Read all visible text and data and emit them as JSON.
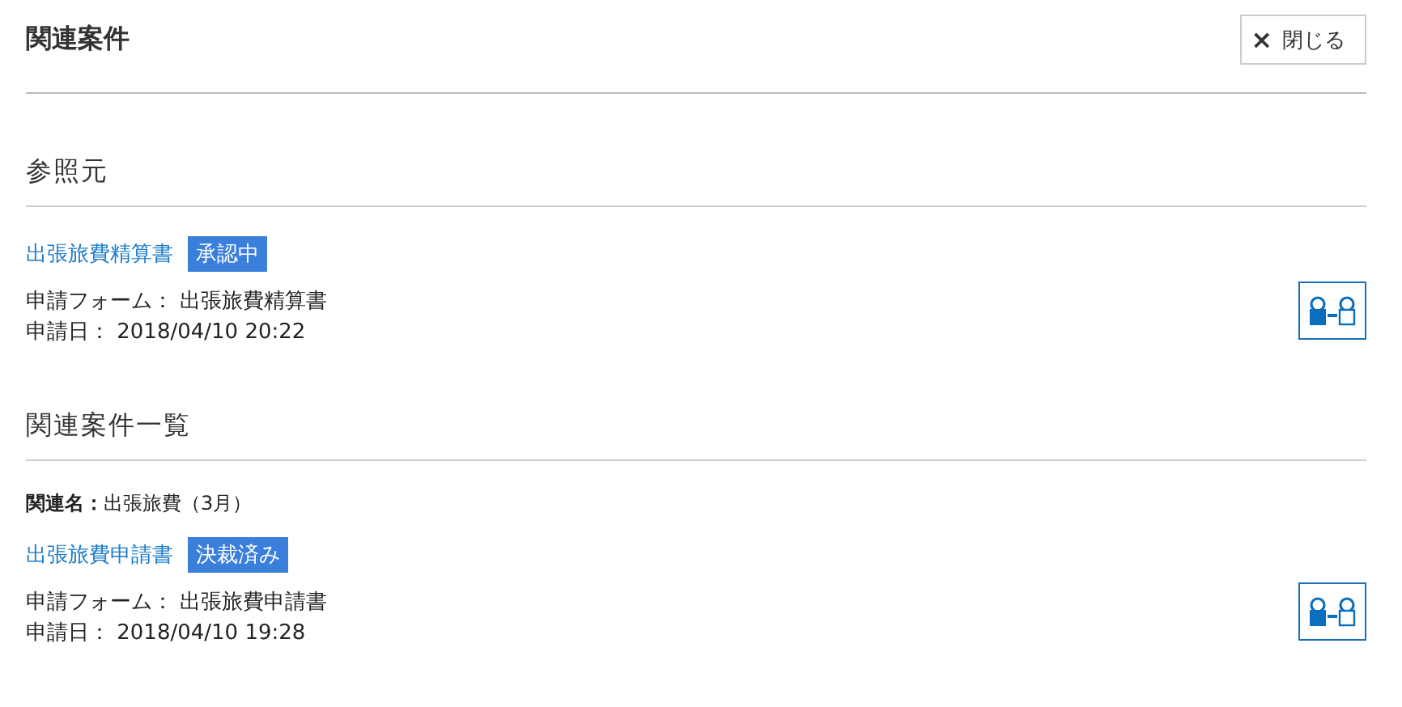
{
  "title": "関連案件",
  "close_button": {
    "icon": "×",
    "label": "閉じる"
  },
  "sections": [
    {
      "heading": "参照元",
      "items": [
        {
          "link": "出張旅費精算書",
          "badge": "承認中",
          "lines": [
            "申請フォーム： 出張旅費精算書",
            "申請日： 2018/04/10 20:22"
          ]
        }
      ]
    },
    {
      "heading": "関連案件一覧",
      "items": [
        {
          "relation": "**関連名：**出張旅費（3月）",
          "link": "出張旅費申請書",
          "badge": "決裁済み",
          "lines": [
            "申請フォーム： 出張旅費申請書",
            "申請日： 2018/04/10 19:28"
          ]
        }
      ]
    }
  ]
}
